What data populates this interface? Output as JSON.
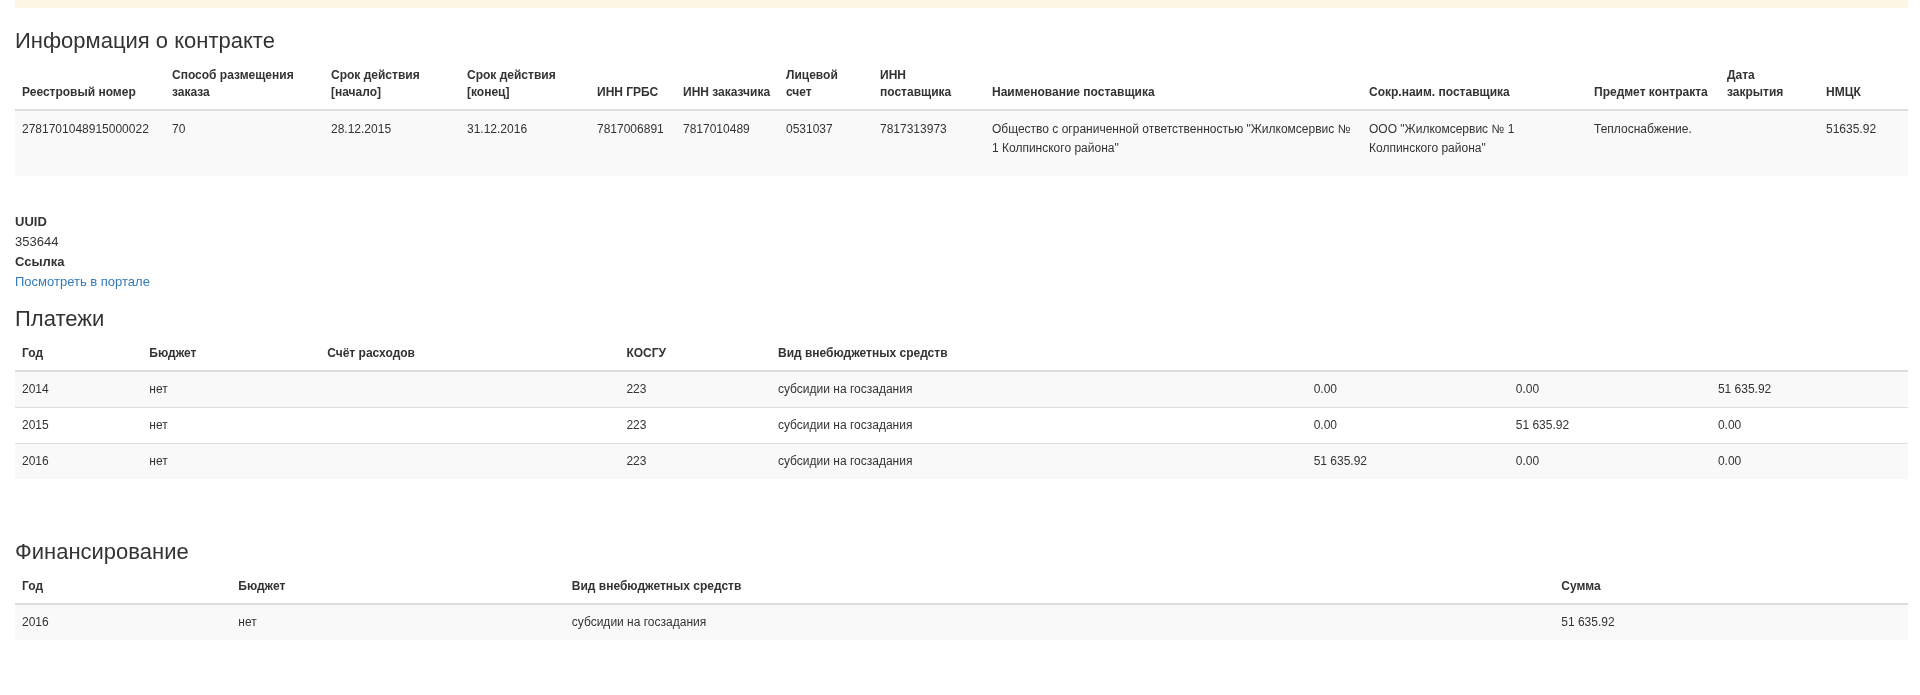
{
  "contract": {
    "title": "Информация о контракте",
    "columns": [
      "Реестровый номер",
      "Способ размещения заказа",
      "Срок действия [начало]",
      "Срок действия [конец]",
      "ИНН ГРБС",
      "ИНН заказчика",
      "Лицевой счет",
      "ИНН поставщика",
      "Наименование поставщика",
      "Сокр.наим. поставщика",
      "Предмет контракта",
      "Дата закрытия",
      "НМЦК"
    ],
    "rows": [
      [
        "2781701048915000022",
        "70",
        "28.12.2015",
        "31.12.2016",
        "7817006891",
        "7817010489",
        "0531037",
        "7817313973",
        "Общество с ограниченной ответственностью \"Жилкомсервис № 1 Колпинского района\"",
        "ООО \"Жилкомсервис № 1 Колпинского района\"",
        "Теплоснабжение.",
        "",
        "51635.92"
      ]
    ]
  },
  "details": [
    {
      "label": "UUID",
      "value": "353644"
    },
    {
      "label": "Ссылка",
      "link": "Посмотреть в портале"
    }
  ],
  "payments": {
    "title": "Платежи",
    "columns": [
      "Год",
      "Бюджет",
      "Счёт расходов",
      "КОСГУ",
      "Вид внебюджетных средств"
    ],
    "rows": [
      [
        "2014",
        "нет",
        "",
        "223",
        "субсидии на госзадания",
        "0.00",
        "0.00",
        "51 635.92"
      ],
      [
        "2015",
        "нет",
        "",
        "223",
        "субсидии на госзадания",
        "0.00",
        "51 635.92",
        "0.00"
      ],
      [
        "2016",
        "нет",
        "",
        "223",
        "субсидии на госзадания",
        "51 635.92",
        "0.00",
        "0.00"
      ]
    ]
  },
  "financing": {
    "title": "Финансирование",
    "columns": [
      "Год",
      "Бюджет",
      "Вид внебюджетных средств",
      "Сумма"
    ],
    "rows": [
      [
        "2016",
        "нет",
        "субсидии на госзадания",
        "51 635.92"
      ]
    ]
  }
}
